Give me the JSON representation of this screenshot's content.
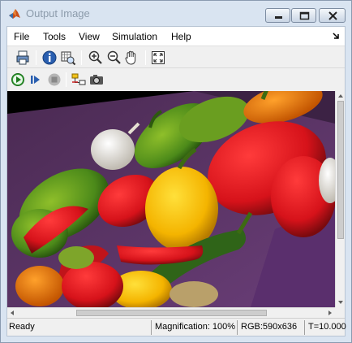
{
  "window": {
    "title": "Output Image"
  },
  "menu": {
    "items": [
      "File",
      "Tools",
      "View",
      "Simulation",
      "Help"
    ]
  },
  "toolbar1": {
    "icons": [
      "print-icon",
      "info-icon",
      "pixel-region-icon",
      "zoom-in-icon",
      "zoom-out-icon",
      "pan-hand-icon",
      "fit-to-window-icon"
    ]
  },
  "toolbar2": {
    "icons": [
      "run-icon",
      "step-forward-icon",
      "stop-icon",
      "highlight-model-icon",
      "snapshot-camera-icon"
    ]
  },
  "status": {
    "ready": "Ready",
    "magnification": "Magnification: 100%",
    "rgb": "RGB:590x636",
    "time": "T=10.000"
  },
  "colors": {
    "run_green": "#2e9e2e",
    "title_gray": "#8c9bab"
  }
}
